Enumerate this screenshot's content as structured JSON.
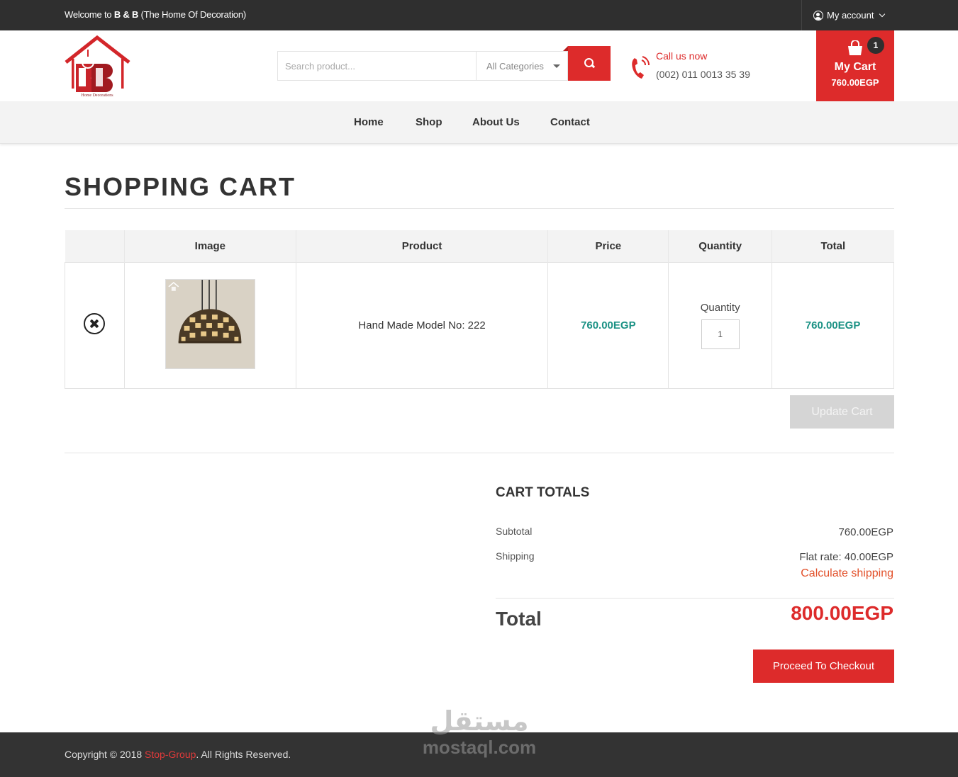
{
  "topbar": {
    "welcome_prefix": "Welcome to ",
    "welcome_brand": "B & B",
    "welcome_suffix": " (The Home Of Decoration)",
    "account_label": "My account",
    "account_icon": "user-circle-icon"
  },
  "header": {
    "logo_tagline": "Home Decorations",
    "search_placeholder": "Search product...",
    "category_selected": "All Categories",
    "call_label": "Call us now",
    "phone_number": "(002) 011 0013 35 39",
    "cart_title": "My Cart",
    "cart_amount": "760.00EGP",
    "cart_count": "1"
  },
  "nav": {
    "items": [
      "Home",
      "Shop",
      "About Us",
      "Contact"
    ]
  },
  "page": {
    "title": "SHOPPING CART"
  },
  "table": {
    "headers": [
      "",
      "Image",
      "Product",
      "Price",
      "Quantity",
      "Total"
    ],
    "rows": [
      {
        "product": "Hand Made Model No: 222",
        "price": "760.00EGP",
        "quantity_label": "Quantity",
        "quantity": "1",
        "total": "760.00EGP"
      }
    ],
    "update_button": "Update Cart"
  },
  "totals": {
    "title": "CART TOTALS",
    "subtotal_label": "Subtotal",
    "subtotal_value": "760.00EGP",
    "shipping_label": "Shipping",
    "shipping_value": "Flat rate: 40.00EGP",
    "calc_shipping": "Calculate shipping",
    "total_label": "Total",
    "total_value": "800.00EGP",
    "checkout_button": "Proceed To Checkout"
  },
  "footer": {
    "copyright_prefix": "Copyright © 2018 ",
    "copyright_brand": "Stop-Group",
    "copyright_suffix": ". All Rights Reserved."
  },
  "watermark": {
    "arabic": "مستقل",
    "latin": "mostaql.com"
  },
  "colors": {
    "accent": "#dd2b2b",
    "price_teal": "#1a9184",
    "topbar_bg": "#2f2f2f",
    "link_orange": "#e2502a"
  }
}
